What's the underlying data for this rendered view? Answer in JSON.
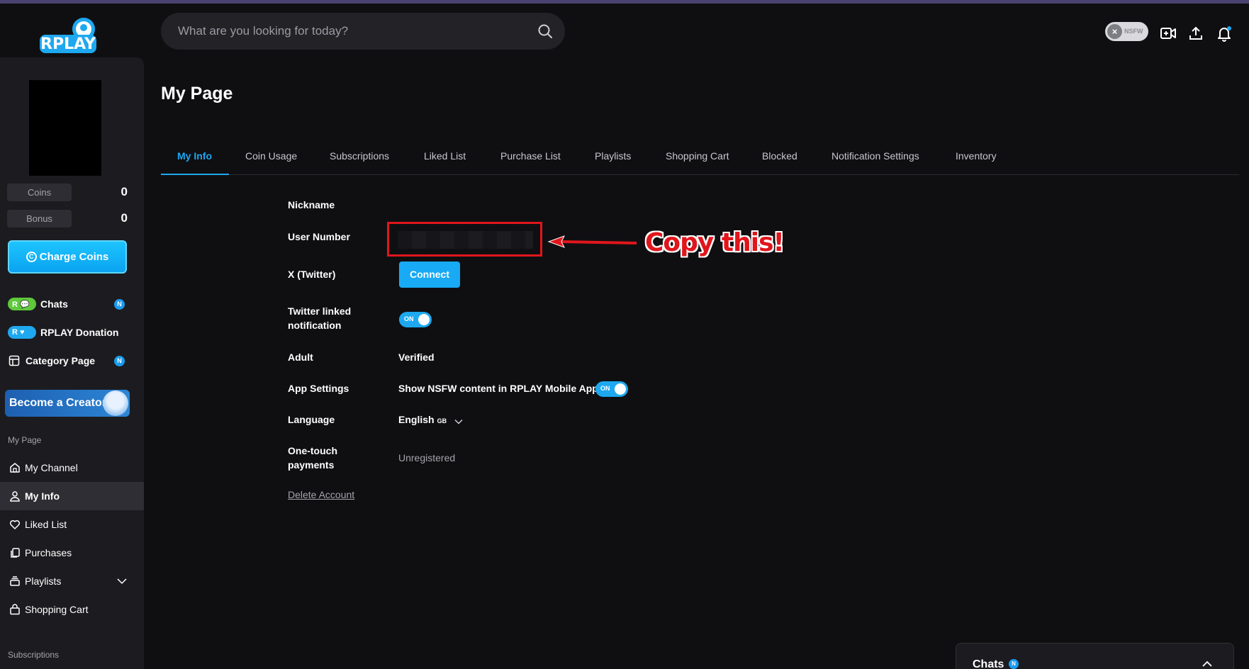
{
  "app": {
    "logo_text": "RPLAY",
    "accent": "#1ea8f0"
  },
  "search": {
    "placeholder": "What are you looking for today?"
  },
  "header": {
    "nsfw_label": "NSFW"
  },
  "sidebar": {
    "stats": [
      {
        "label": "Coins",
        "value": "0"
      },
      {
        "label": "Bonus",
        "value": "0"
      }
    ],
    "charge_label": "Charge Coins",
    "quick_links": [
      {
        "label": "Chats",
        "badge": "N"
      },
      {
        "label": "RPLAY Donation"
      },
      {
        "label": "Category Page",
        "badge": "N"
      }
    ],
    "creator_banner": "Become a Creator!",
    "my_page_section": "My Page",
    "nav": [
      {
        "label": "My Channel",
        "icon": "home-icon"
      },
      {
        "label": "My Info",
        "icon": "user-icon",
        "active": true
      },
      {
        "label": "Liked List",
        "icon": "heart-icon"
      },
      {
        "label": "Purchases",
        "icon": "copy-icon"
      },
      {
        "label": "Playlists",
        "icon": "stack-icon"
      },
      {
        "label": "Shopping Cart",
        "icon": "bag-icon"
      }
    ],
    "subscriptions_section": "Subscriptions"
  },
  "main": {
    "title": "My Page",
    "tabs": [
      {
        "label": "My Info",
        "active": true
      },
      {
        "label": "Coin Usage"
      },
      {
        "label": "Subscriptions"
      },
      {
        "label": "Liked List"
      },
      {
        "label": "Purchase List"
      },
      {
        "label": "Playlists"
      },
      {
        "label": "Shopping Cart"
      },
      {
        "label": "Blocked"
      },
      {
        "label": "Notification Settings"
      },
      {
        "label": "Inventory"
      }
    ],
    "fields": {
      "nickname_label": "Nickname",
      "user_number_label": "User Number",
      "twitter_label": "X (Twitter)",
      "connect_label": "Connect",
      "twitter_notif_label_1": "Twitter linked",
      "twitter_notif_label_2": "notification",
      "toggle_on": "ON",
      "adult_label": "Adult",
      "adult_value": "Verified",
      "app_settings_label": "App Settings",
      "app_settings_value": "Show NSFW content in RPLAY Mobile App",
      "language_label": "Language",
      "language_value": "English",
      "language_region": "GB",
      "one_touch_label_1": "One-touch",
      "one_touch_label_2": "payments",
      "one_touch_value": "Unregistered",
      "delete_account": "Delete Account"
    }
  },
  "annotation": {
    "text": "Copy this!",
    "color": "#e0161c"
  },
  "chat_dock": {
    "title": "Chats",
    "badge": "N"
  }
}
